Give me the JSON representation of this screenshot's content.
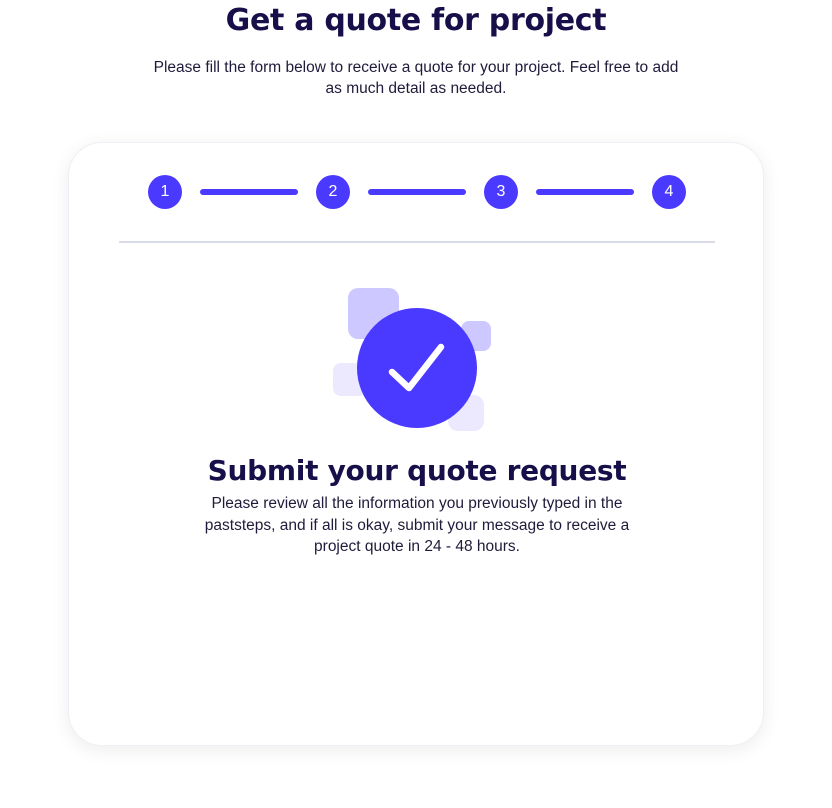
{
  "header": {
    "title": "Get a quote for project",
    "subtitle": "Please fill the form below to receive a quote for your project. Feel free to add as much detail as needed."
  },
  "stepper": {
    "steps": [
      "1",
      "2",
      "3",
      "4"
    ],
    "current_step": 4,
    "completed_segments": 3
  },
  "confirmation": {
    "icon": "checkmark-icon",
    "heading": "Submit your quote request",
    "body": "Please review all the information you previously typed in the paststeps, and if all is okay, submit your message to receive a project quote in 24 - 48 hours."
  },
  "colors": {
    "accent": "#4a3aff",
    "heading": "#170f49",
    "body_text": "#1f1b3a",
    "divider": "#d9dbe9",
    "decor_light": "#ece9ff",
    "decor_medium": "#cdc8ff"
  }
}
